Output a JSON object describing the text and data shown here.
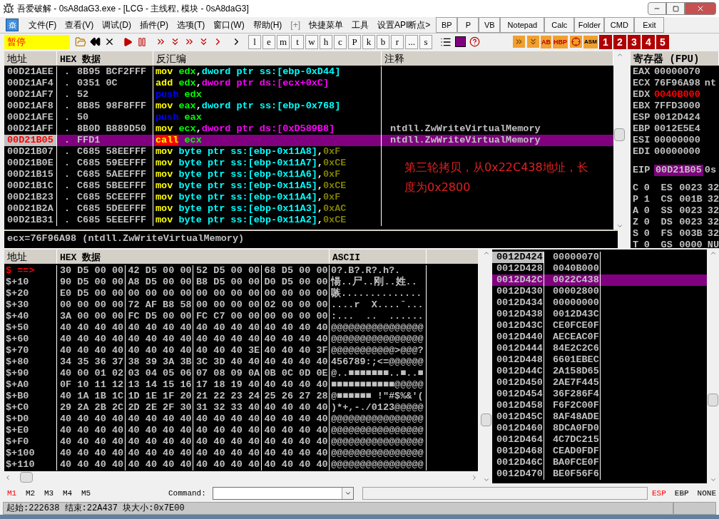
{
  "window": {
    "title": "吾爱破解 - 0sA8daG3.exe - [LCG - 主线程, 模块 - 0sA8daG3]"
  },
  "menu": [
    "文件(F)",
    "查看(V)",
    "调试(D)",
    "插件(P)",
    "选项(T)",
    "窗口(W)",
    "帮助(H)",
    "[+]",
    "快捷菜单",
    "工具",
    "设置API断点>"
  ],
  "quick_buttons": [
    "BP",
    "P",
    "VB",
    "Notepad",
    "Calc",
    "Folder",
    "CMD",
    "Exit"
  ],
  "toolbar": {
    "status": "暂停",
    "letter_buttons": [
      "l",
      "e",
      "m",
      "t",
      "w",
      "h",
      "c",
      "P",
      "k",
      "b",
      "r",
      "...",
      "s"
    ],
    "plugin_labels": [
      "AB",
      "HBP",
      "ASM"
    ],
    "number_buttons": [
      "1",
      "2",
      "3",
      "4",
      "5"
    ]
  },
  "disassembly": {
    "columns": [
      "地址",
      "HEX 数据",
      "反汇编",
      "注释"
    ],
    "rows": [
      {
        "address": "00D21AEE",
        "mark": ".",
        "hex": "8B95 BCF2FFF",
        "selected": false,
        "eip": false,
        "comment": "",
        "asm": [
          {
            "text": "mov",
            "kind": "mnemonic"
          },
          {
            "text": "edx",
            "kind": "register"
          },
          {
            "text": ",",
            "kind": "plain"
          },
          {
            "text": "dword ptr ss:[ebp-0xD44]",
            "kind": "stack_memory"
          }
        ]
      },
      {
        "address": "00D21AF4",
        "mark": ".",
        "hex": "0351 0C",
        "selected": false,
        "eip": false,
        "comment": "",
        "asm": [
          {
            "text": "add",
            "kind": "mnemonic"
          },
          {
            "text": "edx",
            "kind": "register"
          },
          {
            "text": ",",
            "kind": "plain"
          },
          {
            "text": "dword ptr ds:[ecx+0xC]",
            "kind": "data_memory"
          }
        ]
      },
      {
        "address": "00D21AF7",
        "mark": ".",
        "hex": "52",
        "selected": false,
        "eip": false,
        "comment": "",
        "asm": [
          {
            "text": "push",
            "kind": "push"
          },
          {
            "text": "edx",
            "kind": "register"
          }
        ]
      },
      {
        "address": "00D21AF8",
        "mark": ".",
        "hex": "8B85 98F8FFF",
        "selected": false,
        "eip": false,
        "comment": "",
        "asm": [
          {
            "text": "mov",
            "kind": "mnemonic"
          },
          {
            "text": "eax",
            "kind": "register"
          },
          {
            "text": ",",
            "kind": "plain"
          },
          {
            "text": "dword ptr ss:[ebp-0x768]",
            "kind": "stack_memory"
          }
        ]
      },
      {
        "address": "00D21AFE",
        "mark": ".",
        "hex": "50",
        "selected": false,
        "eip": false,
        "comment": "",
        "asm": [
          {
            "text": "push",
            "kind": "push"
          },
          {
            "text": "eax",
            "kind": "register"
          }
        ]
      },
      {
        "address": "00D21AFF",
        "mark": ".",
        "hex": "8B0D B889D50",
        "selected": false,
        "eip": false,
        "comment": "ntdll.ZwWriteVirtualMemory",
        "asm": [
          {
            "text": "mov",
            "kind": "mnemonic"
          },
          {
            "text": "ecx",
            "kind": "register"
          },
          {
            "text": ",",
            "kind": "plain"
          },
          {
            "text": "dword ptr ds:[0xD589B8]",
            "kind": "data_memory"
          }
        ]
      },
      {
        "address": "00D21B05",
        "mark": ".",
        "hex": "FFD1",
        "selected": true,
        "eip": true,
        "comment": "ntdll.ZwWriteVirtualMemory",
        "asm": [
          {
            "text": "call",
            "kind": "call"
          },
          {
            "text": "ecx",
            "kind": "register"
          }
        ]
      },
      {
        "address": "00D21B07",
        "mark": ".",
        "hex": "C685 58EEFFF",
        "selected": false,
        "eip": false,
        "comment": "",
        "asm": [
          {
            "text": "mov",
            "kind": "mnemonic"
          },
          {
            "text": "byte ptr ss:[ebp-0x11A8]",
            "kind": "stack_memory"
          },
          {
            "text": ",",
            "kind": "plain"
          },
          {
            "text": "0xF",
            "kind": "immediate"
          }
        ]
      },
      {
        "address": "00D21B0E",
        "mark": ".",
        "hex": "C685 59EEFFF",
        "selected": false,
        "eip": false,
        "comment": "",
        "asm": [
          {
            "text": "mov",
            "kind": "mnemonic"
          },
          {
            "text": "byte ptr ss:[ebp-0x11A7]",
            "kind": "stack_memory"
          },
          {
            "text": ",",
            "kind": "plain"
          },
          {
            "text": "0xCE",
            "kind": "immediate"
          }
        ]
      },
      {
        "address": "00D21B15",
        "mark": ".",
        "hex": "C685 5AEEFFF",
        "selected": false,
        "eip": false,
        "comment": "",
        "asm": [
          {
            "text": "mov",
            "kind": "mnemonic"
          },
          {
            "text": "byte ptr ss:[ebp-0x11A6]",
            "kind": "stack_memory"
          },
          {
            "text": ",",
            "kind": "plain"
          },
          {
            "text": "0xF",
            "kind": "immediate"
          }
        ]
      },
      {
        "address": "00D21B1C",
        "mark": ".",
        "hex": "C685 5BEEFFF",
        "selected": false,
        "eip": false,
        "comment": "",
        "asm": [
          {
            "text": "mov",
            "kind": "mnemonic"
          },
          {
            "text": "byte ptr ss:[ebp-0x11A5]",
            "kind": "stack_memory"
          },
          {
            "text": ",",
            "kind": "plain"
          },
          {
            "text": "0xCE",
            "kind": "immediate"
          }
        ]
      },
      {
        "address": "00D21B23",
        "mark": ".",
        "hex": "C685 5CEEFFF",
        "selected": false,
        "eip": false,
        "comment": "",
        "asm": [
          {
            "text": "mov",
            "kind": "mnemonic"
          },
          {
            "text": "byte ptr ss:[ebp-0x11A4]",
            "kind": "stack_memory"
          },
          {
            "text": ",",
            "kind": "plain"
          },
          {
            "text": "0xF",
            "kind": "immediate"
          }
        ]
      },
      {
        "address": "00D21B2A",
        "mark": ".",
        "hex": "C685 5DEEFFF",
        "selected": false,
        "eip": false,
        "comment": "",
        "asm": [
          {
            "text": "mov",
            "kind": "mnemonic"
          },
          {
            "text": "byte ptr ss:[ebp-0x11A3]",
            "kind": "stack_memory"
          },
          {
            "text": ",",
            "kind": "plain"
          },
          {
            "text": "0xAC",
            "kind": "immediate"
          }
        ]
      },
      {
        "address": "00D21B31",
        "mark": ".",
        "hex": "C685 5EEEFFF",
        "selected": false,
        "eip": false,
        "comment": "",
        "asm": [
          {
            "text": "mov",
            "kind": "mnemonic"
          },
          {
            "text": "byte ptr ss:[ebp-0x11A2]",
            "kind": "stack_memory"
          },
          {
            "text": ",",
            "kind": "plain"
          },
          {
            "text": "0xCE",
            "kind": "immediate"
          }
        ]
      }
    ],
    "annotation": "第三轮拷贝，从0x22C438地址，长度为0x2800",
    "info_line": "ecx=76F96A98 (ntdll.ZwWriteVirtualMemory)"
  },
  "registers": {
    "title": "寄存器 (FPU)",
    "rows": [
      {
        "name": "EAX",
        "value": "00000070",
        "extra": "",
        "changed": false
      },
      {
        "name": "ECX",
        "value": "76F96A98",
        "extra": "nt",
        "changed": false
      },
      {
        "name": "EDX",
        "value": "0040B000",
        "extra": "",
        "changed": true
      },
      {
        "name": "EBX",
        "value": "7FFD3000",
        "extra": "",
        "changed": false
      },
      {
        "name": "ESP",
        "value": "0012D424",
        "extra": "",
        "changed": false
      },
      {
        "name": "EBP",
        "value": "0012E5E4",
        "extra": "",
        "changed": false
      },
      {
        "name": "ESI",
        "value": "00000000",
        "extra": "",
        "changed": false
      },
      {
        "name": "EDI",
        "value": "00000000",
        "extra": "",
        "changed": false
      }
    ],
    "eip": {
      "name": "EIP",
      "value": "00D21B05",
      "extra": "0s"
    },
    "flags": [
      {
        "flag": "C",
        "bit": "0",
        "segment": "ES",
        "selector": "0023",
        "extra": "32"
      },
      {
        "flag": "P",
        "bit": "1",
        "segment": "CS",
        "selector": "001B",
        "extra": "32"
      },
      {
        "flag": "A",
        "bit": "0",
        "segment": "SS",
        "selector": "0023",
        "extra": "32"
      },
      {
        "flag": "Z",
        "bit": "0",
        "segment": "DS",
        "selector": "0023",
        "extra": "32"
      },
      {
        "flag": "S",
        "bit": "0",
        "segment": "FS",
        "selector": "003B",
        "extra": "32"
      },
      {
        "flag": "T",
        "bit": "0",
        "segment": "GS",
        "selector": "0000",
        "extra": "NU"
      }
    ]
  },
  "dump": {
    "columns": [
      "地址",
      "HEX 数据",
      "ASCII"
    ],
    "rows": [
      {
        "address": "$ ==>",
        "current": true,
        "hex": [
          "30 D5 00 00",
          "42 D5 00 00",
          "52 D5 00 00",
          "68 D5 00 00"
        ],
        "ascii": "0?.B?.R?.h?."
      },
      {
        "address": "$+10",
        "current": false,
        "hex": [
          "90 D5 00 00",
          "A8 D5 00 00",
          "B8 D5 00 00",
          "D0 D5 00 00"
        ],
        "ascii": "愓..尸..刚..姓.."
      },
      {
        "address": "$+20",
        "current": false,
        "hex": [
          "E0 D5 00 00",
          "00 00 00 00",
          "00 00 00 00",
          "00 00 00 00"
        ],
        "ascii": "嗾.............."
      },
      {
        "address": "$+30",
        "current": false,
        "hex": [
          "00 00 00 00",
          "72 AF B8 58",
          "00 00 00 00",
          "02 00 00 00"
        ],
        "ascii": "....r  X....ˉ..."
      },
      {
        "address": "$+40",
        "current": false,
        "hex": [
          "3A 00 00 00",
          "FC D5 00 00",
          "FC C7 00 00",
          "00 00 00 00"
        ],
        "ascii": ":...  ..  ......"
      },
      {
        "address": "$+50",
        "current": false,
        "hex": [
          "40 40 40 40",
          "40 40 40 40",
          "40 40 40 40",
          "40 40 40 40"
        ],
        "ascii": "@@@@@@@@@@@@@@@@"
      },
      {
        "address": "$+60",
        "current": false,
        "hex": [
          "40 40 40 40",
          "40 40 40 40",
          "40 40 40 40",
          "40 40 40 40"
        ],
        "ascii": "@@@@@@@@@@@@@@@@"
      },
      {
        "address": "$+70",
        "current": false,
        "hex": [
          "40 40 40 40",
          "40 40 40 40",
          "40 40 40 3E",
          "40 40 40 3F"
        ],
        "ascii": "@@@@@@@@@@@>@@@?"
      },
      {
        "address": "$+80",
        "current": false,
        "hex": [
          "34 35 36 37",
          "38 39 3A 3B",
          "3C 3D 40 40",
          "40 40 40 40"
        ],
        "ascii": "456789:;<=@@@@@@"
      },
      {
        "address": "$+90",
        "current": false,
        "hex": [
          "40 00 01 02",
          "03 04 05 06",
          "07 08 09 0A",
          "0B 0C 0D 0E"
        ],
        "ascii": "@..■■■■■■■..■..■"
      },
      {
        "address": "$+A0",
        "current": false,
        "hex": [
          "0F 10 11 12",
          "13 14 15 16",
          "17 18 19 40",
          "40 40 40 40"
        ],
        "ascii": "■■■■■■■■■■■@@@@@"
      },
      {
        "address": "$+B0",
        "current": false,
        "hex": [
          "40 1A 1B 1C",
          "1D 1E 1F 20",
          "21 22 23 24",
          "25 26 27 28"
        ],
        "ascii": "@■■■■■■ !\"#$%&'("
      },
      {
        "address": "$+C0",
        "current": false,
        "hex": [
          "29 2A 2B 2C",
          "2D 2E 2F 30",
          "31 32 33 40",
          "40 40 40 40"
        ],
        "ascii": ")*+,-./0123@@@@@"
      },
      {
        "address": "$+D0",
        "current": false,
        "hex": [
          "40 40 40 40",
          "40 40 40 40",
          "40 40 40 40",
          "40 40 40 40"
        ],
        "ascii": "@@@@@@@@@@@@@@@@"
      },
      {
        "address": "$+E0",
        "current": false,
        "hex": [
          "40 40 40 40",
          "40 40 40 40",
          "40 40 40 40",
          "40 40 40 40"
        ],
        "ascii": "@@@@@@@@@@@@@@@@"
      },
      {
        "address": "$+F0",
        "current": false,
        "hex": [
          "40 40 40 40",
          "40 40 40 40",
          "40 40 40 40",
          "40 40 40 40"
        ],
        "ascii": "@@@@@@@@@@@@@@@@"
      },
      {
        "address": "$+100",
        "current": false,
        "hex": [
          "40 40 40 40",
          "40 40 40 40",
          "40 40 40 40",
          "40 40 40 40"
        ],
        "ascii": "@@@@@@@@@@@@@@@@"
      },
      {
        "address": "$+110",
        "current": false,
        "hex": [
          "40 40 40 40",
          "40 40 40 40",
          "40 40 40 40",
          "40 40 40 40"
        ],
        "ascii": "@@@@@@@@@@@@@@@@"
      }
    ]
  },
  "stack": {
    "rows": [
      {
        "address": "0012D424",
        "value": "00000070",
        "top": true,
        "selected": false
      },
      {
        "address": "0012D428",
        "value": "0040B000",
        "top": false,
        "selected": false
      },
      {
        "address": "0012D42C",
        "value": "0022C438",
        "top": false,
        "selected": true
      },
      {
        "address": "0012D430",
        "value": "00002800",
        "top": false,
        "selected": false
      },
      {
        "address": "0012D434",
        "value": "00000000",
        "top": false,
        "selected": false
      },
      {
        "address": "0012D438",
        "value": "0012D43C",
        "top": false,
        "selected": false
      },
      {
        "address": "0012D43C",
        "value": "CE0FCE0F",
        "top": false,
        "selected": false
      },
      {
        "address": "0012D440",
        "value": "AECEAC0F",
        "top": false,
        "selected": false
      },
      {
        "address": "0012D444",
        "value": "84E2C2C6",
        "top": false,
        "selected": false
      },
      {
        "address": "0012D448",
        "value": "6601EBEC",
        "top": false,
        "selected": false
      },
      {
        "address": "0012D44C",
        "value": "2A158D65",
        "top": false,
        "selected": false
      },
      {
        "address": "0012D450",
        "value": "2AE7F445",
        "top": false,
        "selected": false
      },
      {
        "address": "0012D454",
        "value": "36F286F4",
        "top": false,
        "selected": false
      },
      {
        "address": "0012D458",
        "value": "F6F2C00F",
        "top": false,
        "selected": false
      },
      {
        "address": "0012D45C",
        "value": "8AF48ADE",
        "top": false,
        "selected": false
      },
      {
        "address": "0012D460",
        "value": "8DCA0FD0",
        "top": false,
        "selected": false
      },
      {
        "address": "0012D464",
        "value": "4C7DC215",
        "top": false,
        "selected": false
      },
      {
        "address": "0012D468",
        "value": "CEAD0FDF",
        "top": false,
        "selected": false
      },
      {
        "address": "0012D46C",
        "value": "BA0FCE0F",
        "top": false,
        "selected": false
      },
      {
        "address": "0012D470",
        "value": "BE0F56F6",
        "top": false,
        "selected": false
      }
    ]
  },
  "command_bar": {
    "dump_tabs": [
      {
        "label": "M1",
        "selected": true
      },
      {
        "label": "M2",
        "selected": false
      },
      {
        "label": "M3",
        "selected": false
      },
      {
        "label": "M4",
        "selected": false
      },
      {
        "label": "M5",
        "selected": false
      }
    ],
    "command_label": "Command:",
    "stack_modes": [
      {
        "label": "ESP",
        "selected": true
      },
      {
        "label": "EBP",
        "selected": false
      },
      {
        "label": "NONE",
        "selected": false
      }
    ]
  },
  "status_bar": "起始:222638 结束:22A437 块大小:0x7E00"
}
